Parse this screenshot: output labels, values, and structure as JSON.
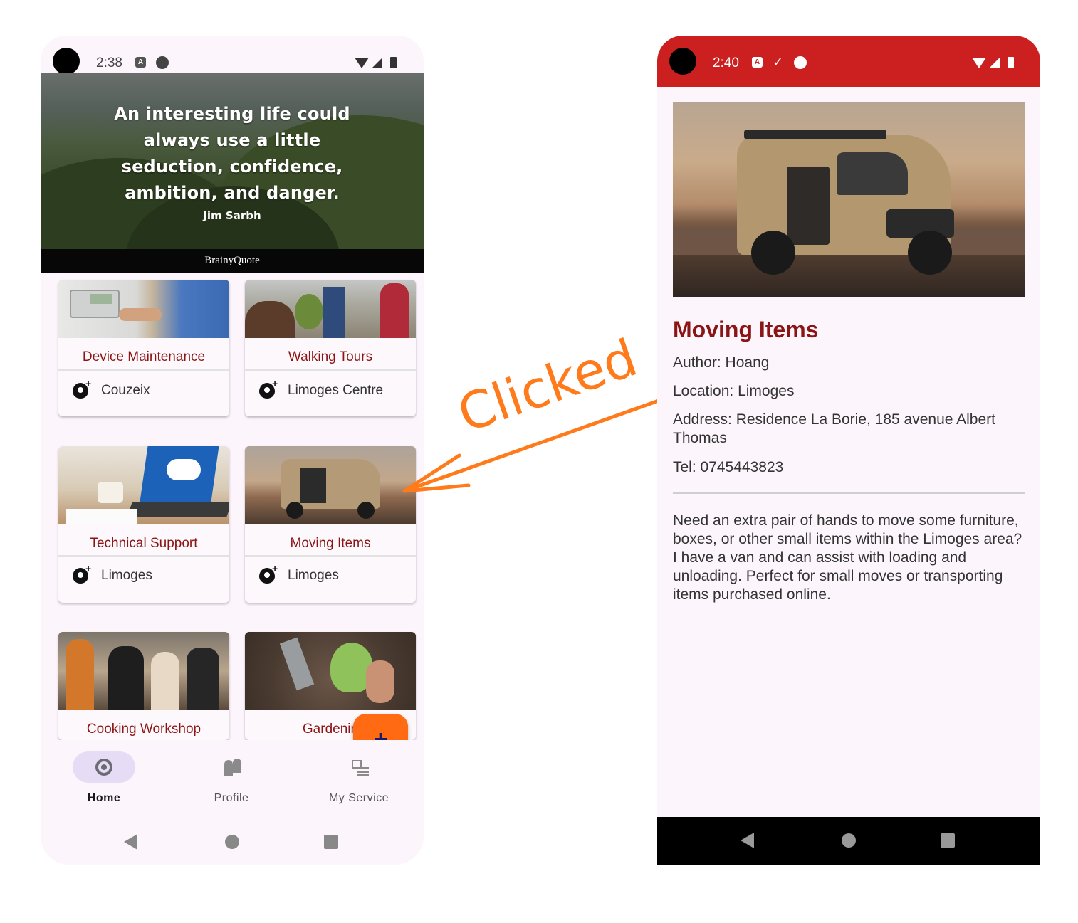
{
  "annotation": {
    "label": "Clicked",
    "color": "#ff7a1a"
  },
  "left_screen": {
    "status": {
      "time": "2:38"
    },
    "banner": {
      "quote": [
        "An interesting life could",
        "always use a little",
        "seduction, confidence,",
        "ambition, and danger."
      ],
      "author": "Jim Sarbh",
      "brand": "BrainyQuote"
    },
    "cards": [
      {
        "title": "Device Maintenance",
        "location": "Couzeix"
      },
      {
        "title": "Walking Tours",
        "location": "Limoges Centre"
      },
      {
        "title": "Technical Support",
        "location": "Limoges"
      },
      {
        "title": "Moving Items",
        "location": "Limoges"
      },
      {
        "title": "Cooking Workshop",
        "location": ""
      },
      {
        "title": "Gardenin",
        "location": ""
      }
    ],
    "fab": {
      "icon": "plus-icon",
      "label": "+"
    },
    "bottom_nav": [
      {
        "label": "Home",
        "icon": "crosshair-icon",
        "selected": true
      },
      {
        "label": "Profile",
        "icon": "people-icon",
        "selected": false
      },
      {
        "label": "My Service",
        "icon": "list-icon",
        "selected": false
      }
    ],
    "colors": {
      "accent": "#8b1414",
      "fab": "#ff6a13",
      "nav_pill": "#e7dcf5"
    }
  },
  "right_screen": {
    "status": {
      "time": "2:40",
      "bar_color": "#cc1f1f"
    },
    "title": "Moving Items",
    "author": "Author: Hoang",
    "location": "Location: Limoges",
    "address": "Address: Residence La Borie, 185 avenue Albert Thomas",
    "tel": "Tel: 0745443823",
    "description": "Need an extra pair of hands to move some furniture, boxes, or other small items within the Limoges area? I have a van and can assist with loading and unloading. Perfect for small moves or transporting items purchased online."
  }
}
